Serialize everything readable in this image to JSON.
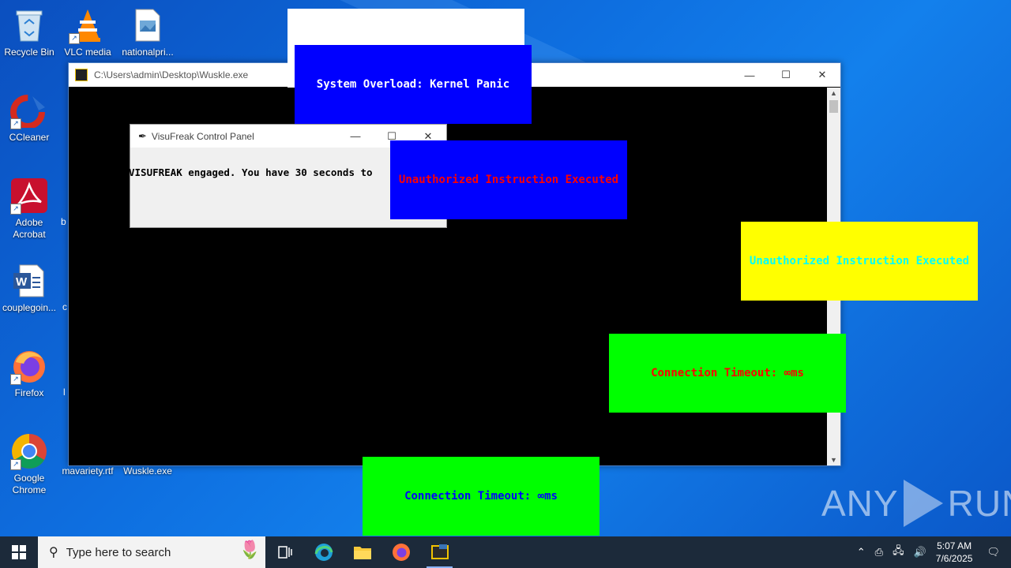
{
  "desktop": {
    "icons": [
      {
        "label": "Recycle Bin",
        "icon": "recycle-bin-icon"
      },
      {
        "label": "VLC media",
        "icon": "vlc-icon"
      },
      {
        "label": "nationalpri...",
        "icon": "image-file-icon"
      },
      {
        "label": "CCleaner",
        "icon": "ccleaner-icon"
      },
      {
        "label": "Adobe Acrobat",
        "icon": "acrobat-icon"
      },
      {
        "label": "couplegoin...",
        "icon": "word-doc-icon"
      },
      {
        "label": "Firefox",
        "icon": "firefox-icon"
      },
      {
        "label": "Google Chrome",
        "icon": "chrome-icon"
      },
      {
        "label": "mavariety.rtf",
        "icon": "rtf-file-icon"
      },
      {
        "label": "Wuskle.exe",
        "icon": "exe-file-icon"
      }
    ],
    "partial_labels": [
      "b",
      "c",
      "l"
    ]
  },
  "console_window": {
    "title": "C:\\Users\\admin\\Desktop\\Wuskle.exe"
  },
  "control_panel": {
    "title": "VisuFreak Control Panel",
    "message": "VISUFREAK engaged. You have 30 seconds to"
  },
  "popups": [
    {
      "text": "System Overload: Kernel Panic",
      "bg": "#0000ff",
      "fg": "#ffffff"
    },
    {
      "text": "Unauthorized Instruction Executed",
      "bg": "#0000ff",
      "fg": "#ff0000"
    },
    {
      "text": "Unauthorized Instruction Executed",
      "bg": "#ffff00",
      "fg": "#00ffff"
    },
    {
      "text": "Connection Timeout: ∞ms",
      "bg": "#00ff00",
      "fg": "#ff0000"
    },
    {
      "text": "Connection Timeout: ∞ms",
      "bg": "#00ff00",
      "fg": "#0000ff"
    }
  ],
  "watermark": {
    "left": "ANY",
    "right": "RUN"
  },
  "taskbar": {
    "search_placeholder": "Type here to search",
    "time": "5:07 AM",
    "date": "7/6/2025"
  }
}
